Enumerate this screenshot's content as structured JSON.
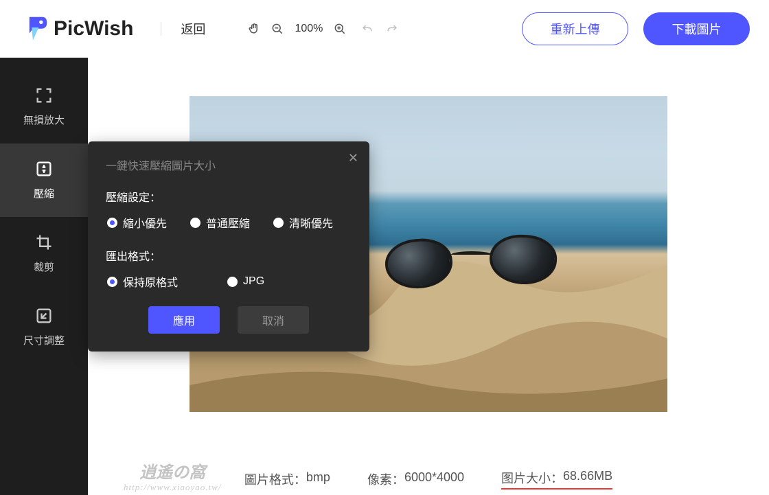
{
  "brand": {
    "name": "PicWish"
  },
  "header": {
    "back": "返回",
    "zoom": "100%",
    "reupload": "重新上傳",
    "download": "下載圖片"
  },
  "sidebar": {
    "items": [
      {
        "label": "無損放大"
      },
      {
        "label": "壓縮"
      },
      {
        "label": "裁剪"
      },
      {
        "label": "尺寸調整"
      }
    ]
  },
  "dialog": {
    "title": "一鍵快速壓縮圖片大小",
    "section_compress": "壓縮設定：",
    "compress_options": [
      "縮小優先",
      "普通壓縮",
      "清晰優先"
    ],
    "compress_selected": 0,
    "section_format": "匯出格式：",
    "format_options": [
      "保持原格式",
      "JPG"
    ],
    "format_selected": 0,
    "apply": "應用",
    "cancel": "取消"
  },
  "info": {
    "format_label": "圖片格式：",
    "format_value": "bmp",
    "pixels_label": "像素：",
    "pixels_value": "6000*4000",
    "size_label": "图片大小：",
    "size_value": "68.66MB"
  },
  "watermark": {
    "top": "逍遙の窩",
    "url": "http://www.xiaoyao.tw/"
  }
}
